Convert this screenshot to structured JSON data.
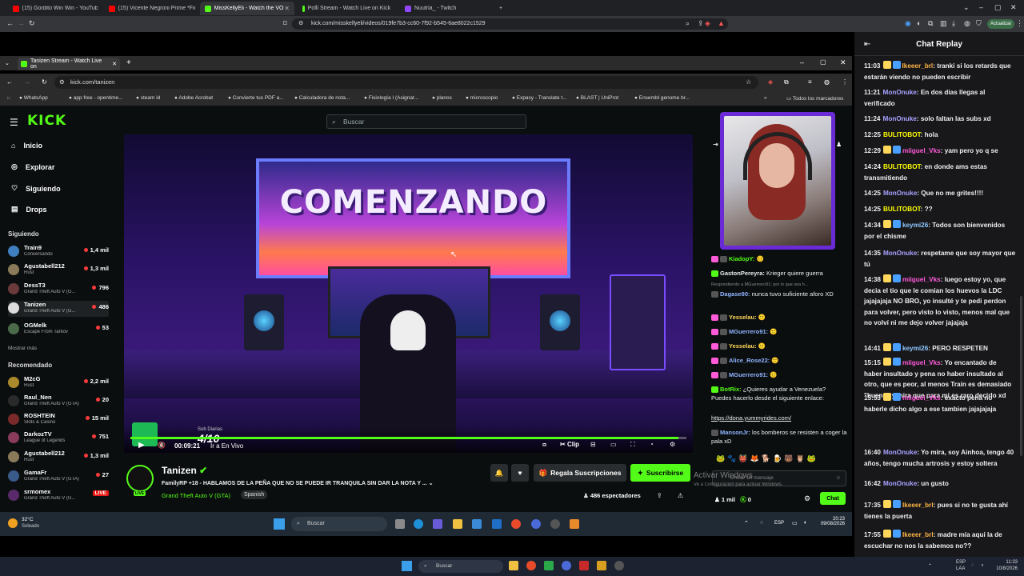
{
  "browser": {
    "tabs": [
      {
        "label": "(15) Gordito Win Win - YouTube",
        "color": "#ff0000",
        "active": false
      },
      {
        "label": "(15) Vicente Negroni Prime *Final 10...",
        "color": "#ff0000",
        "active": false
      },
      {
        "label": "MissKellyEli - Watch the VOD",
        "color": "#53fc18",
        "active": true
      },
      {
        "label": "Polli Stream - Watch Live on Kick",
        "color": "#53fc18",
        "active": false
      },
      {
        "label": "Nuutria_ - Twitch",
        "color": "#9146ff",
        "active": false
      }
    ],
    "url": "kick.com/misskellyeli/videos/019fe7b3-cc60-7f92-b545-6ae8022c1529",
    "update_label": "Actualizar"
  },
  "inner_browser": {
    "tab_label": "Tanizen Stream - Watch Live on",
    "url": "kick.com/tanizen",
    "bookmarks": [
      "WhatsApp",
      "app free - opentime...",
      "steam id",
      "Adobe Acrobat",
      "Convierte tus PDF a...",
      "Calculadora de nota...",
      "Fisiología I (Asignat...",
      "planos",
      "microscopio",
      "Expasy - Translate t...",
      "BLAST | UniProt",
      "Ensembl genome br..."
    ],
    "all_bookmarks": "Todos los marcadores"
  },
  "kick": {
    "logo": "KICK",
    "search_placeholder": "Buscar",
    "nav": [
      {
        "label": "Inicio",
        "icon": "home-icon"
      },
      {
        "label": "Explorar",
        "icon": "compass-icon"
      },
      {
        "label": "Siguiendo",
        "icon": "heart-icon"
      },
      {
        "label": "Drops",
        "icon": "drops-icon"
      }
    ],
    "following_title": "Siguiendo",
    "following": [
      {
        "name": "Train9",
        "game": "Conversando",
        "viewers": "1,4 mil"
      },
      {
        "name": "Agustabell212",
        "game": "Rust",
        "viewers": "1,3 mil"
      },
      {
        "name": "DessT3",
        "game": "Grand Theft Auto V (G...",
        "viewers": "796"
      },
      {
        "name": "Tanizen",
        "game": "Grand Theft Auto V (G...",
        "viewers": "486"
      },
      {
        "name": "OGMelk",
        "game": "Escape From Tarkov",
        "viewers": "53"
      }
    ],
    "show_more": "Mostrar más",
    "recommended_title": "Recomendado",
    "recommended": [
      {
        "name": "M2cG",
        "game": "Rust",
        "viewers": "2,2 mil"
      },
      {
        "name": "Raul_Nen",
        "game": "Grand Theft Auto V (GTA)",
        "viewers": "20"
      },
      {
        "name": "ROSHTEIN",
        "game": "Slots & Casino",
        "viewers": "15 mil"
      },
      {
        "name": "DarkozTV",
        "game": "League of Legends",
        "viewers": "751"
      },
      {
        "name": "Agustabell212",
        "game": "Rust",
        "viewers": "1,3 mil"
      },
      {
        "name": "GamaFr",
        "game": "Grand Theft Auto V (GTA)",
        "viewers": "27"
      },
      {
        "name": "srmomex",
        "game": "Grand Theft Auto V (G...",
        "viewers": "LIVE"
      }
    ],
    "video": {
      "screen_title": "COMENZANDO",
      "sub_label": "Sub Diarias",
      "sub_count": "4/10",
      "time": "00:09:21",
      "live_label": "Ir a En Vivo",
      "clip_label": "Clip",
      "progress": 0.985
    },
    "streamer": {
      "name": "Tanizen",
      "title": "FamilyRP +18 - HABLAMOS DE LA PEÑA QUE NO SE PUEDE IR TRANQUILA SIN DAR LA NOTA Y ...",
      "category": "Grand Theft Auto V (GTA)",
      "language": "Spanish",
      "viewers": "486 espectadores",
      "gift_subs": "Regala Suscripciones",
      "subscribe": "Suscribirse",
      "live_badge": "LIVE"
    },
    "chat": [
      {
        "user": "KiadopY:",
        "color": "#53fc18",
        "text": ""
      },
      {
        "user": "GastonPereyra:",
        "color": "#ffffff",
        "text": "Krieger quiere guerra"
      },
      {
        "user": "Respondiendo a MGuerrero91: por lo que sea h...",
        "color": "#888888",
        "text": ""
      },
      {
        "user": "Dagase90:",
        "color": "#8fb4ff",
        "text": "nunca tuvo suficiente aforo XD"
      },
      {
        "user": "Yesselau:",
        "color": "#ffd75a",
        "text": ""
      },
      {
        "user": "MGuerrero91:",
        "color": "#8fb4ff",
        "text": ""
      },
      {
        "user": "Yesselau:",
        "color": "#ffd75a",
        "text": ""
      },
      {
        "user": "Alice_Rose22:",
        "color": "#8fb4ff",
        "text": ""
      },
      {
        "user": "MGuerrero91:",
        "color": "#8fb4ff",
        "text": ""
      },
      {
        "user": "BotRix:",
        "color": "#53fc18",
        "text": "¿Quieres ayudar a Venezuela? Puedes hacerlo desde el siguiente enlace:"
      },
      {
        "user": "",
        "color": "#ffffff",
        "text": "https://dona.yummyrides.com/"
      },
      {
        "user": "MansonJr:",
        "color": "#8fb4ff",
        "text": "los bomberos se resisten a coger la pala xD"
      }
    ],
    "chat_placeholder": "Enviar un mensaje",
    "chat_button": "Chat",
    "chat_count": "1 mil",
    "chat_kicks": "0",
    "watermark_line1": "Activar Windows",
    "watermark_line2": "Ve a Configuración para activar Windows."
  },
  "inner_taskbar": {
    "weather_temp": "32°C",
    "weather_desc": "Soleado",
    "search": "Buscar",
    "lang": "ESP",
    "time": "20:23",
    "date": "09/08/2026"
  },
  "chat_replay": {
    "title": "Chat Replay",
    "messages": [
      {
        "time": "11:03",
        "badge": "#ffd75a",
        "user": "Ikeeer_brl",
        "color": "#ffb545",
        "text": "tranki si los retards que estarán viendo no pueden escribir"
      },
      {
        "time": "11:21",
        "badge": "",
        "user": "MonOnuke",
        "color": "#a8a2ff",
        "text": "En dos dias llegas al verificado"
      },
      {
        "time": "11:24",
        "badge": "",
        "user": "MonOnuke",
        "color": "#a8a2ff",
        "text": "solo faltan las subs xd"
      },
      {
        "time": "12:25",
        "badge": "",
        "user": "BULITOBOT",
        "color": "#ffff00",
        "text": "hola"
      },
      {
        "time": "12:29",
        "badge": "#ffd75a",
        "user": "miiguel_Vks",
        "color": "#ff5ad8",
        "text": "yam pero yo q se"
      },
      {
        "time": "14:24",
        "badge": "",
        "user": "BULITOBOT",
        "color": "#ffff00",
        "text": "en donde ams estas transmitiendo"
      },
      {
        "time": "14:25",
        "badge": "",
        "user": "MonOnuke",
        "color": "#a8a2ff",
        "text": "Que no me grites!!!!"
      },
      {
        "time": "14:25",
        "badge": "",
        "user": "BULITOBOT",
        "color": "#ffff00",
        "text": "??"
      },
      {
        "time": "14:34",
        "badge": "#ffd75a",
        "user": "keymi26",
        "color": "#8fc8ff",
        "text": "Todos son bienvenidos por el chisme"
      },
      {
        "time": "14:35",
        "badge": "",
        "user": "MonOnuke",
        "color": "#a8a2ff",
        "text": "respetame que soy mayor que tú"
      },
      {
        "time": "14:38",
        "badge": "#ffd75a",
        "user": "miiguel_Vks",
        "color": "#ff5ad8",
        "text": "luego estoy yo, que decia el tio que le comian los huevos la LDC jajajajaja NO BRO, yo insulté y te pedi perdon para volver, pero visto lo visto, menos mal que no volví ni me dejo volver jajajaja"
      },
      {
        "time": "14:41",
        "badge": "#ffd75a",
        "user": "keymi26",
        "color": "#8fc8ff",
        "text": "PERO RESPETEN"
      },
      {
        "time": "15:15",
        "badge": "#ffd75a",
        "user": "miiguel_Vks",
        "color": "#ff5ad8",
        "text": "Yo encantado de haber insultado y pena no haber insultado al otro, que es peor, al menos Train es demasiado \"bueno\" y mira que para mi es raro decirlo xd"
      },
      {
        "time": "15:53",
        "badge": "#ffd75a",
        "user": "miiguel_Vks",
        "color": "#ff5ad8",
        "text": "exacto pena no haberle dicho algo a ese tambien jajajajaja"
      },
      {
        "time": "16:40",
        "badge": "",
        "user": "MonOnuke",
        "color": "#a8a2ff",
        "text": "Yo mira, soy Ainhoa, tengo 40 años, tengo mucha artrosis y estoy soltera"
      },
      {
        "time": "16:42",
        "badge": "",
        "user": "MonOnuke",
        "color": "#a8a2ff",
        "text": "un gusto"
      },
      {
        "time": "17:35",
        "badge": "#ffd75a",
        "user": "Ikeeer_brl",
        "color": "#ffb545",
        "text": "pues si no te gusta ahí tienes la puerta"
      },
      {
        "time": "17:55",
        "badge": "#ffd75a",
        "user": "Ikeeer_brl",
        "color": "#ffb545",
        "text": "madre mía aqui la de escuchar no nos la sabemos no??"
      }
    ]
  },
  "taskbar": {
    "search": "Buscar",
    "lang1": "ESP",
    "lang2": "LAA",
    "time": "11:33",
    "date": "10/8/2026"
  }
}
